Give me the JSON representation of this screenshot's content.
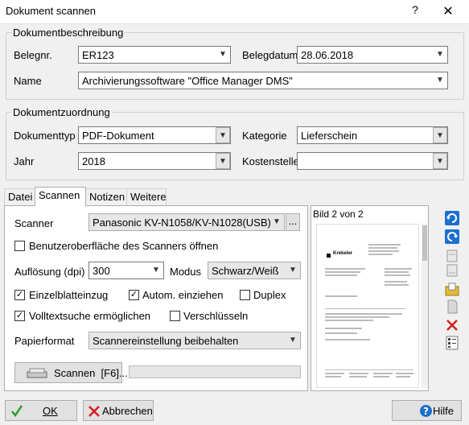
{
  "window": {
    "title": "Dokument scannen",
    "help_label": "?",
    "close_label": "✕"
  },
  "beschreibung": {
    "legend": "Dokumentbeschreibung",
    "belegnr_label": "Belegnr.",
    "belegnr_value": "ER123",
    "belegdatum_label": "Belegdatum",
    "belegdatum_value": "28.06.2018",
    "name_label": "Name",
    "name_value": "Archivierungssoftware \"Office Manager DMS\""
  },
  "zuordnung": {
    "legend": "Dokumentzuordnung",
    "typ_label": "Dokumenttyp",
    "typ_value": "PDF-Dokument",
    "kategorie_label": "Kategorie",
    "kategorie_value": "Lieferschein",
    "jahr_label": "Jahr",
    "jahr_value": "2018",
    "kostenstelle_label": "Kostenstelle",
    "kostenstelle_value": ""
  },
  "tabs": [
    "Datei",
    "Scannen",
    "Notizen",
    "Weitere"
  ],
  "scannen": {
    "scanner_label": "Scanner",
    "scanner_value": "Panasonic KV-N1058/KV-N1028(USB)",
    "scanner_more": "...",
    "ui_label": "Benutzeroberfläche des Scanners öffnen",
    "ui_checked": false,
    "aufloesung_label": "Auflösung (dpi)",
    "aufloesung_value": "300",
    "modus_label": "Modus",
    "modus_value": "Schwarz/Weiß",
    "einzelblatt_label": "Einzelblatteinzug",
    "einzelblatt_checked": true,
    "autom_label": "Autom. einziehen",
    "autom_checked": true,
    "duplex_label": "Duplex",
    "duplex_checked": false,
    "volltext_label": "Volltextsuche ermöglichen",
    "volltext_checked": true,
    "verschl_label": "Verschlüsseln",
    "verschl_checked": false,
    "papier_label": "Papierformat",
    "papier_value": "Scannereinstellung beibehalten",
    "scan_button": "Scannen  [F6]..."
  },
  "preview": {
    "page_label": "Bild 2 von 2",
    "brand": "Krekeler"
  },
  "footer": {
    "ok": "OK",
    "abbrechen": "Abbrechen",
    "hilfe": "Hilfe"
  },
  "colors": {
    "accent_blue": "#1c6fd0",
    "ok_green": "#2e9b2e",
    "cancel_red": "#d42020"
  }
}
